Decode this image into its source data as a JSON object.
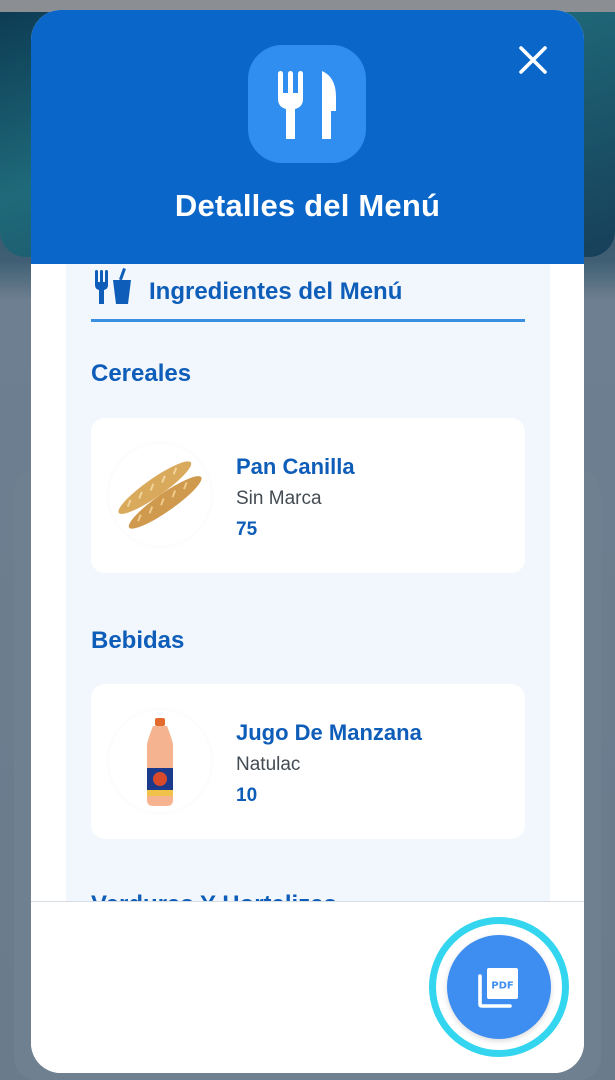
{
  "modal": {
    "title": "Detalles del Menú",
    "header_icon": "fork-knife-icon",
    "close_icon": "close-icon"
  },
  "section": {
    "title": "Ingredientes del Menú",
    "icon": "utensils-drink-icon"
  },
  "categories": [
    {
      "title": "Cereales",
      "items": [
        {
          "name": "Pan Canilla",
          "brand": "Sin Marca",
          "quantity": "75",
          "image": "baguette-bread"
        }
      ]
    },
    {
      "title": "Bebidas",
      "items": [
        {
          "name": "Jugo De Manzana",
          "brand": "Natulac",
          "quantity": "10",
          "image": "juice-bottle"
        }
      ]
    },
    {
      "title": "Verduras Y Hortalizas",
      "items": []
    }
  ],
  "footer": {
    "pdf_icon": "pdf-file-icon",
    "pdf_label": "PDF"
  },
  "colors": {
    "primary": "#0a66c8",
    "accent": "#3d8ef0",
    "text_blue": "#0e5db8",
    "ring": "#33d6ee",
    "content_bg": "#f1f7fd"
  }
}
